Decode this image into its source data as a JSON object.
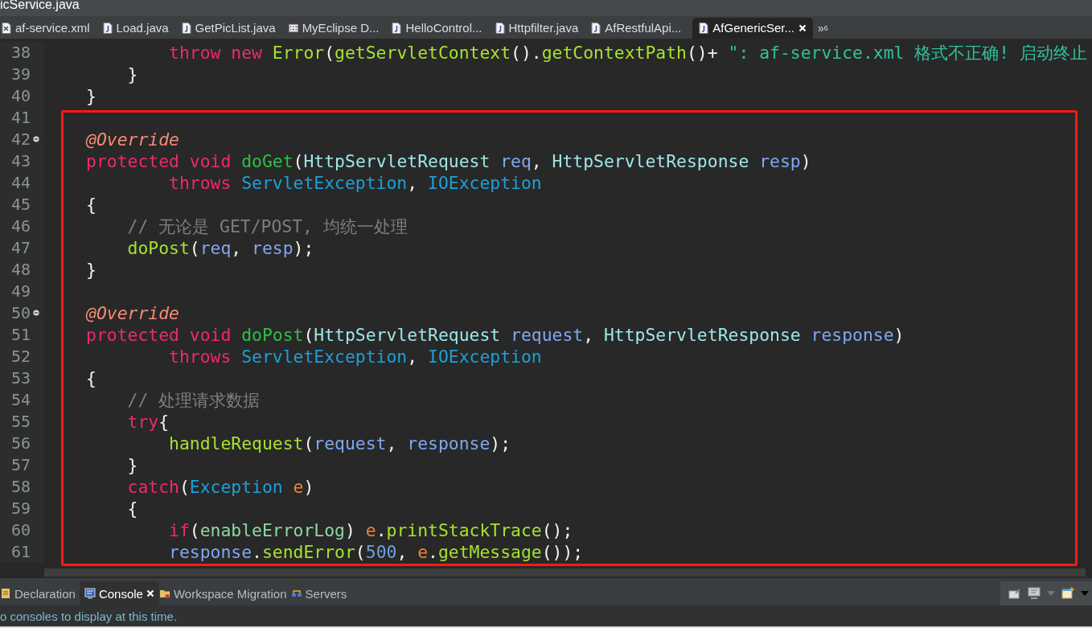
{
  "window": {
    "title": "icService.java"
  },
  "editor_tabs": [
    {
      "label": "af-service.xml",
      "kind": "xml",
      "selected": false
    },
    {
      "label": "Load.java",
      "kind": "java",
      "selected": false
    },
    {
      "label": "GetPicList.java",
      "kind": "java",
      "selected": false
    },
    {
      "label": "MyEclipse D...",
      "kind": "grid",
      "selected": false
    },
    {
      "label": "HelloControl...",
      "kind": "java",
      "selected": false
    },
    {
      "label": "Httpfilter.java",
      "kind": "java",
      "selected": false
    },
    {
      "label": "AfRestfulApi...",
      "kind": "java",
      "selected": false
    },
    {
      "label": "AfGenericSer...",
      "kind": "java",
      "selected": true
    }
  ],
  "tab_overflow": {
    "symbol": "»",
    "count": "6"
  },
  "code_lines": [
    {
      "number": "38",
      "fold": false,
      "tokens": [
        {
          "kind": "kw",
          "t": "        throw new "
        },
        {
          "kind": "call",
          "t": "Error"
        },
        {
          "kind": "plain",
          "t": "("
        },
        {
          "kind": "call",
          "t": "getServletContext"
        },
        {
          "kind": "plain",
          "t": "()."
        },
        {
          "kind": "call",
          "t": "getContextPath"
        },
        {
          "kind": "plain",
          "t": "()+ "
        },
        {
          "kind": "str",
          "t": "\": af-service.xml 格式不正确! 启动终止"
        }
      ]
    },
    {
      "number": "39",
      "fold": false,
      "tokens": [
        {
          "kind": "plain",
          "t": "    }"
        }
      ]
    },
    {
      "number": "40",
      "fold": false,
      "tokens": [
        {
          "kind": "plain",
          "t": "}"
        }
      ]
    },
    {
      "number": "41",
      "fold": false
    },
    {
      "number": "42",
      "fold": true,
      "tokens": [
        {
          "kind": "ann",
          "t": "@Override"
        }
      ]
    },
    {
      "number": "43",
      "fold": false,
      "tokens": [
        {
          "kind": "kw",
          "t": "protected void "
        },
        {
          "kind": "decl",
          "t": "doGet"
        },
        {
          "kind": "plain",
          "t": "("
        },
        {
          "kind": "class",
          "t": "HttpServletRequest "
        },
        {
          "kind": "param",
          "t": "req"
        },
        {
          "kind": "plain",
          "t": ", "
        },
        {
          "kind": "class",
          "t": "HttpServletResponse "
        },
        {
          "kind": "param",
          "t": "resp"
        },
        {
          "kind": "plain",
          "t": ")"
        }
      ]
    },
    {
      "number": "44",
      "fold": false,
      "tokens": [
        {
          "kind": "kw",
          "t": "        throws "
        },
        {
          "kind": "exc",
          "t": "ServletException"
        },
        {
          "kind": "plain",
          "t": ", "
        },
        {
          "kind": "exc",
          "t": "IOException"
        }
      ]
    },
    {
      "number": "45",
      "fold": false,
      "tokens": [
        {
          "kind": "plain",
          "t": "{"
        }
      ]
    },
    {
      "number": "46",
      "fold": false,
      "tokens": [
        {
          "kind": "comment",
          "t": "    // 无论是 GET/POST, 均统一处理"
        }
      ]
    },
    {
      "number": "47",
      "fold": false,
      "tokens": [
        {
          "kind": "call",
          "t": "    doPost"
        },
        {
          "kind": "plain",
          "t": "("
        },
        {
          "kind": "param",
          "t": "req"
        },
        {
          "kind": "plain",
          "t": ", "
        },
        {
          "kind": "param",
          "t": "resp"
        },
        {
          "kind": "plain",
          "t": ");"
        }
      ]
    },
    {
      "number": "48",
      "fold": false,
      "tokens": [
        {
          "kind": "plain",
          "t": "}"
        }
      ]
    },
    {
      "number": "49",
      "fold": false
    },
    {
      "number": "50",
      "fold": true,
      "tokens": [
        {
          "kind": "ann",
          "t": "@Override"
        }
      ]
    },
    {
      "number": "51",
      "fold": false,
      "tokens": [
        {
          "kind": "kw",
          "t": "protected void "
        },
        {
          "kind": "decl",
          "t": "doPost"
        },
        {
          "kind": "plain",
          "t": "("
        },
        {
          "kind": "class",
          "t": "HttpServletRequest "
        },
        {
          "kind": "param",
          "t": "request"
        },
        {
          "kind": "plain",
          "t": ", "
        },
        {
          "kind": "class",
          "t": "HttpServletResponse "
        },
        {
          "kind": "param",
          "t": "response"
        },
        {
          "kind": "plain",
          "t": ")"
        }
      ]
    },
    {
      "number": "52",
      "fold": false,
      "tokens": [
        {
          "kind": "kw",
          "t": "        throws "
        },
        {
          "kind": "exc",
          "t": "ServletException"
        },
        {
          "kind": "plain",
          "t": ", "
        },
        {
          "kind": "exc",
          "t": "IOException"
        }
      ]
    },
    {
      "number": "53",
      "fold": false,
      "tokens": [
        {
          "kind": "plain",
          "t": "{"
        }
      ]
    },
    {
      "number": "54",
      "fold": false,
      "tokens": [
        {
          "kind": "comment",
          "t": "    // 处理请求数据"
        }
      ]
    },
    {
      "number": "55",
      "fold": false,
      "tokens": [
        {
          "kind": "kw",
          "t": "    try"
        },
        {
          "kind": "plain",
          "t": "{"
        }
      ]
    },
    {
      "number": "56",
      "fold": false,
      "tokens": [
        {
          "kind": "call",
          "t": "        handleRequest"
        },
        {
          "kind": "plain",
          "t": "("
        },
        {
          "kind": "param",
          "t": "request"
        },
        {
          "kind": "plain",
          "t": ", "
        },
        {
          "kind": "param",
          "t": "response"
        },
        {
          "kind": "plain",
          "t": ");"
        }
      ]
    },
    {
      "number": "57",
      "fold": false,
      "tokens": [
        {
          "kind": "plain",
          "t": "    }"
        }
      ]
    },
    {
      "number": "58",
      "fold": false,
      "tokens": [
        {
          "kind": "kw",
          "t": "    catch"
        },
        {
          "kind": "plain",
          "t": "("
        },
        {
          "kind": "exc",
          "t": "Exception "
        },
        {
          "kind": "local",
          "t": "e"
        },
        {
          "kind": "plain",
          "t": ")"
        }
      ]
    },
    {
      "number": "59",
      "fold": false,
      "tokens": [
        {
          "kind": "plain",
          "t": "    {"
        }
      ]
    },
    {
      "number": "60",
      "fold": false,
      "tokens": [
        {
          "kind": "kw",
          "t": "        if"
        },
        {
          "kind": "plain",
          "t": "("
        },
        {
          "kind": "field",
          "t": "enableErrorLog"
        },
        {
          "kind": "plain",
          "t": ") "
        },
        {
          "kind": "local",
          "t": "e"
        },
        {
          "kind": "plain",
          "t": "."
        },
        {
          "kind": "call",
          "t": "printStackTrace"
        },
        {
          "kind": "plain",
          "t": "();"
        }
      ]
    },
    {
      "number": "61",
      "fold": false,
      "tokens": [
        {
          "kind": "param",
          "t": "        response"
        },
        {
          "kind": "plain",
          "t": "."
        },
        {
          "kind": "call",
          "t": "sendError"
        },
        {
          "kind": "plain",
          "t": "("
        },
        {
          "kind": "num",
          "t": "500"
        },
        {
          "kind": "plain",
          "t": ", "
        },
        {
          "kind": "local",
          "t": "e"
        },
        {
          "kind": "plain",
          "t": "."
        },
        {
          "kind": "call",
          "t": "getMessage"
        },
        {
          "kind": "plain",
          "t": "());"
        }
      ]
    }
  ],
  "panel_tabs": [
    {
      "label": "Declaration",
      "kind": "declaration",
      "selected": false
    },
    {
      "label": "Console",
      "kind": "console",
      "selected": true
    },
    {
      "label": "Workspace Migration",
      "kind": "migration",
      "selected": false
    },
    {
      "label": "Servers",
      "kind": "servers",
      "selected": false
    }
  ],
  "console": {
    "message": "o consoles to display at this time."
  }
}
